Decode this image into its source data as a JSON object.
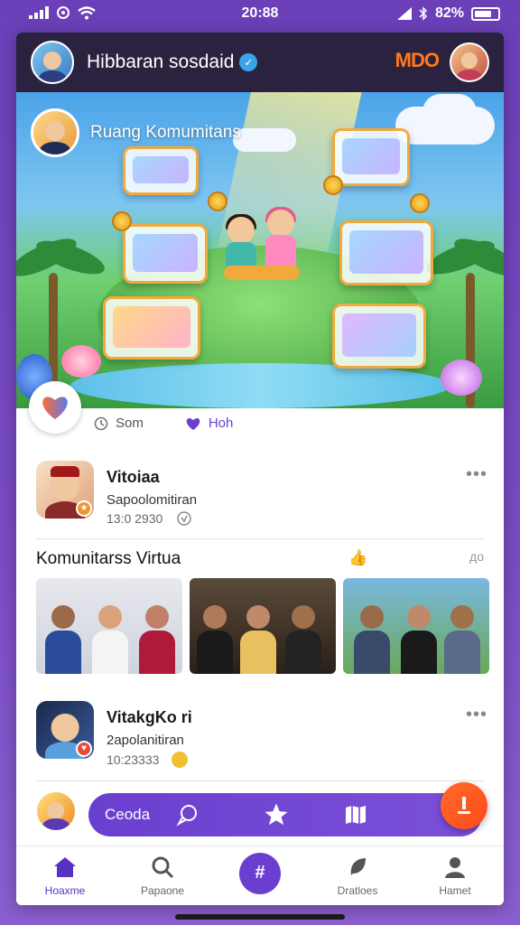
{
  "status_bar": {
    "time": "20:88",
    "battery": "82%"
  },
  "header": {
    "title": "Hibbaran sosdaid",
    "brand": "MDO"
  },
  "hero": {
    "title": "Ruang Komumitans"
  },
  "reactions": {
    "first_label": "Som",
    "second_label": "Hoh"
  },
  "posts": [
    {
      "name": "Vitoiaa",
      "subtitle": "Sapoolomitiran",
      "time": "13:0 2930"
    },
    {
      "name": "VitakgKo ri",
      "subtitle": "2apolanitiran",
      "time": "10:23333"
    }
  ],
  "section": {
    "title": "Komunitarss Virtua",
    "extra": "👍",
    "extra2": "до"
  },
  "action_bar": {
    "label": "Ceoda"
  },
  "nav": {
    "items": [
      {
        "label": "Hoaxme"
      },
      {
        "label": "Papaone"
      },
      {
        "label": ""
      },
      {
        "label": "Dratloes"
      },
      {
        "label": "Hamet"
      }
    ]
  },
  "colors": {
    "brand_purple": "#6a3fd0",
    "header_dark": "#2b2240",
    "fab_orange": "#ff5a1f"
  }
}
